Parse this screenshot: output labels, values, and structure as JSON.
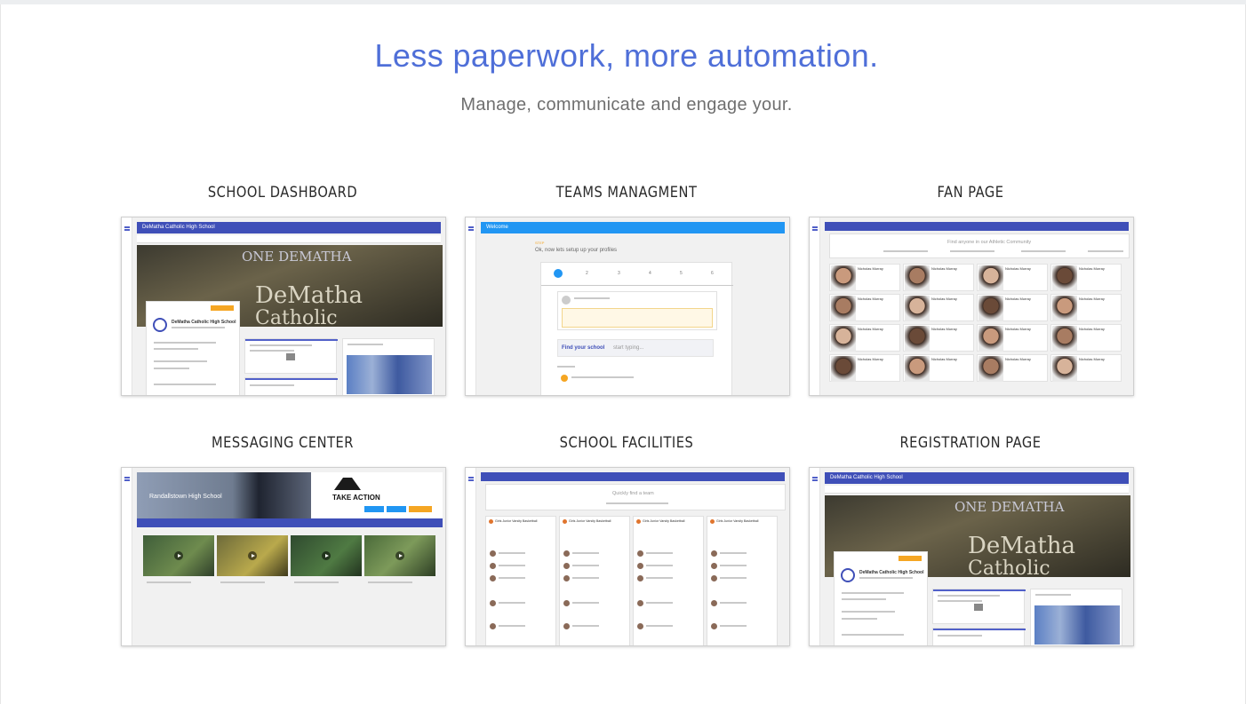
{
  "hero": {
    "headline": "Less paperwork, more automation.",
    "subheadline": "Manage, communicate and engage your."
  },
  "cards": [
    {
      "title": "SCHOOL DASHBOARD",
      "app_title": "DeMatha Catholic High School",
      "sign_1": "ONE DEMATHA",
      "sign_2": "DeMatha",
      "sign_3": "Catholic",
      "panel_title": "DeMatha Catholic High School"
    },
    {
      "title": "TEAMS MANAGMENT",
      "app_title": "Welcome",
      "step_text": "Ok, now lets setup up your profiles",
      "search_label": "Find your school",
      "search_placeholder": "start typing..."
    },
    {
      "title": "FAN PAGE",
      "search_placeholder": "Find anyone in our Athletic Community",
      "person_name": "Nicholas Murray"
    },
    {
      "title": "MESSAGING CENTER",
      "school_name": "Randallstown High School",
      "sponsor": "TAKE ACTION"
    },
    {
      "title": "SCHOOL FACILITIES",
      "search_placeholder": "Quickly find a team",
      "team_name": "Girls Junior Varsity Basketball"
    },
    {
      "title": "REGISTRATION PAGE",
      "app_title": "DeMatha Catholic High School",
      "sign_1": "ONE DEMATHA",
      "sign_2": "DeMatha",
      "sign_3": "Catholic",
      "panel_title": "DeMatha Catholic High School"
    }
  ],
  "colors": {
    "headline": "#4f6fd8",
    "app_bar": "#3f4fb8",
    "app_bar_welcome": "#2196f3",
    "cta_orange": "#f5a623"
  }
}
